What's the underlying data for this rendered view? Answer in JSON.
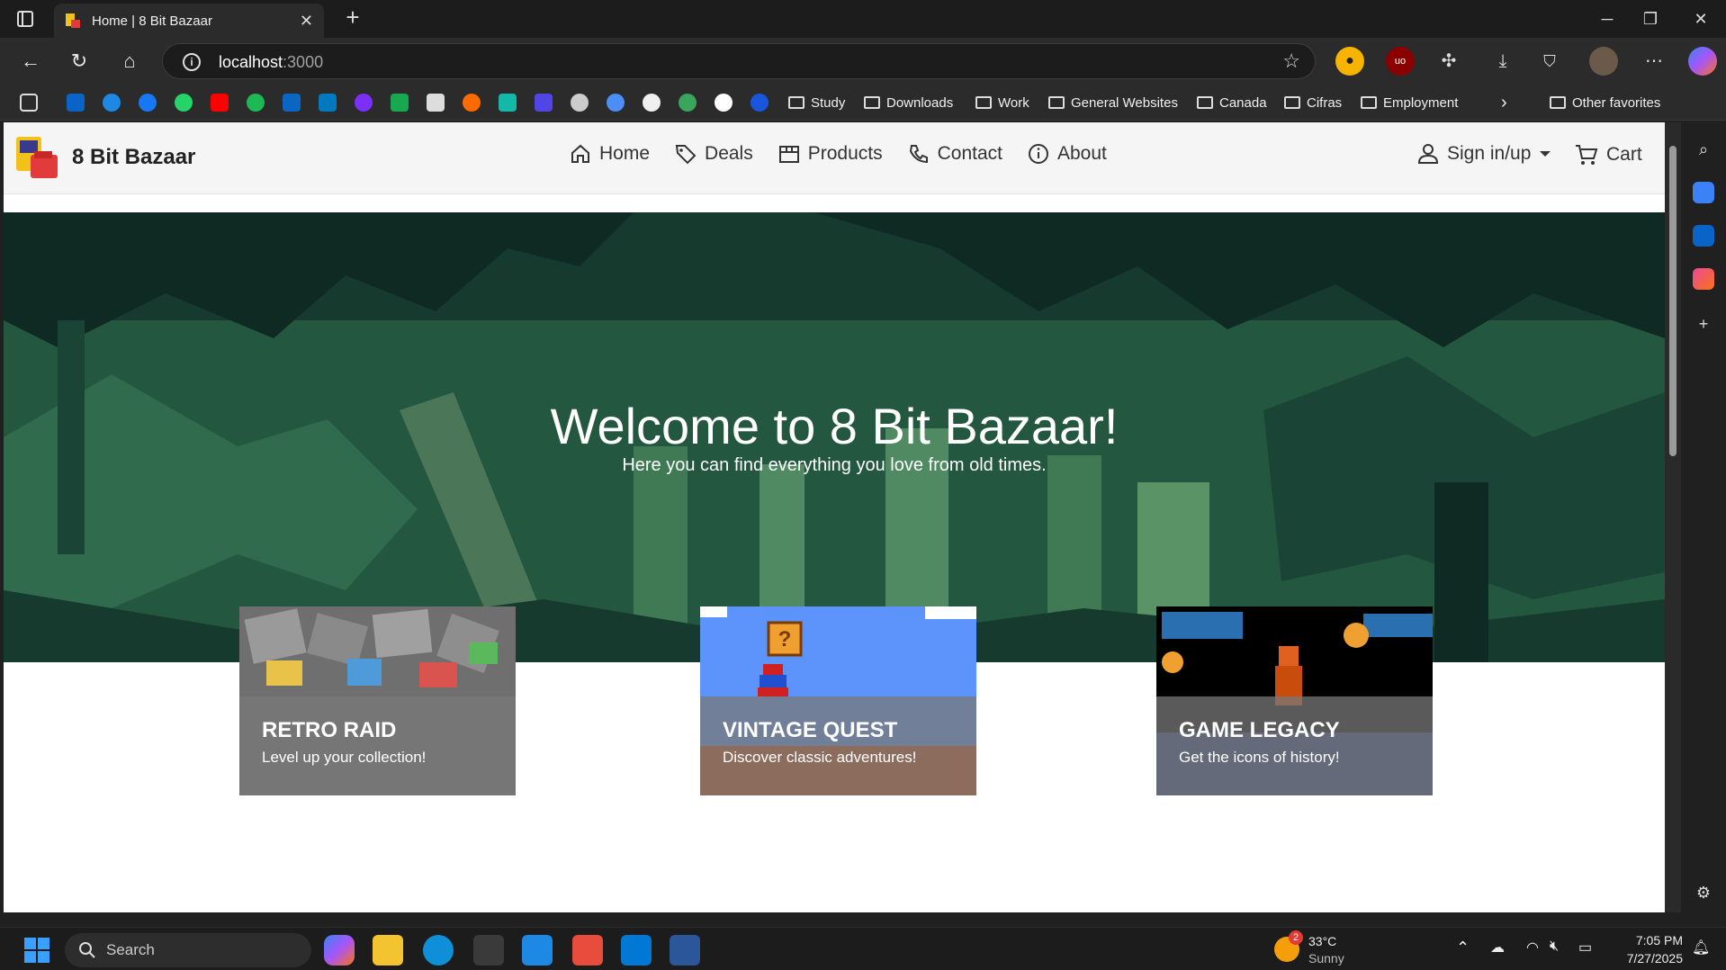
{
  "browser": {
    "tab_title": "Home | 8 Bit Bazaar",
    "url_host": "localhost",
    "url_port": ":3000",
    "bookmark_folders": [
      "Study",
      "Downloads",
      "Work",
      "General Websites",
      "Canada",
      "Cifras",
      "Employment"
    ],
    "other_favorites": "Other favorites"
  },
  "site": {
    "brand": "8 Bit Bazaar",
    "nav": [
      "Home",
      "Deals",
      "Products",
      "Contact",
      "About"
    ],
    "signin": "Sign in/up",
    "cart": "Cart"
  },
  "hero": {
    "title": "Welcome to 8 Bit Bazaar!",
    "subtitle": "Here you can find everything you love from old times."
  },
  "cards": [
    {
      "title": "RETRO RAID",
      "text": "Level up your collection!"
    },
    {
      "title": "VINTAGE QUEST",
      "text": "Discover classic adventures!"
    },
    {
      "title": "GAME LEGACY",
      "text": "Get the icons of history!"
    }
  ],
  "taskbar": {
    "search": "Search",
    "weather_badge": "2",
    "temp": "33°C",
    "weather": "Sunny",
    "time": "7:05 PM",
    "date": "7/27/2025"
  }
}
